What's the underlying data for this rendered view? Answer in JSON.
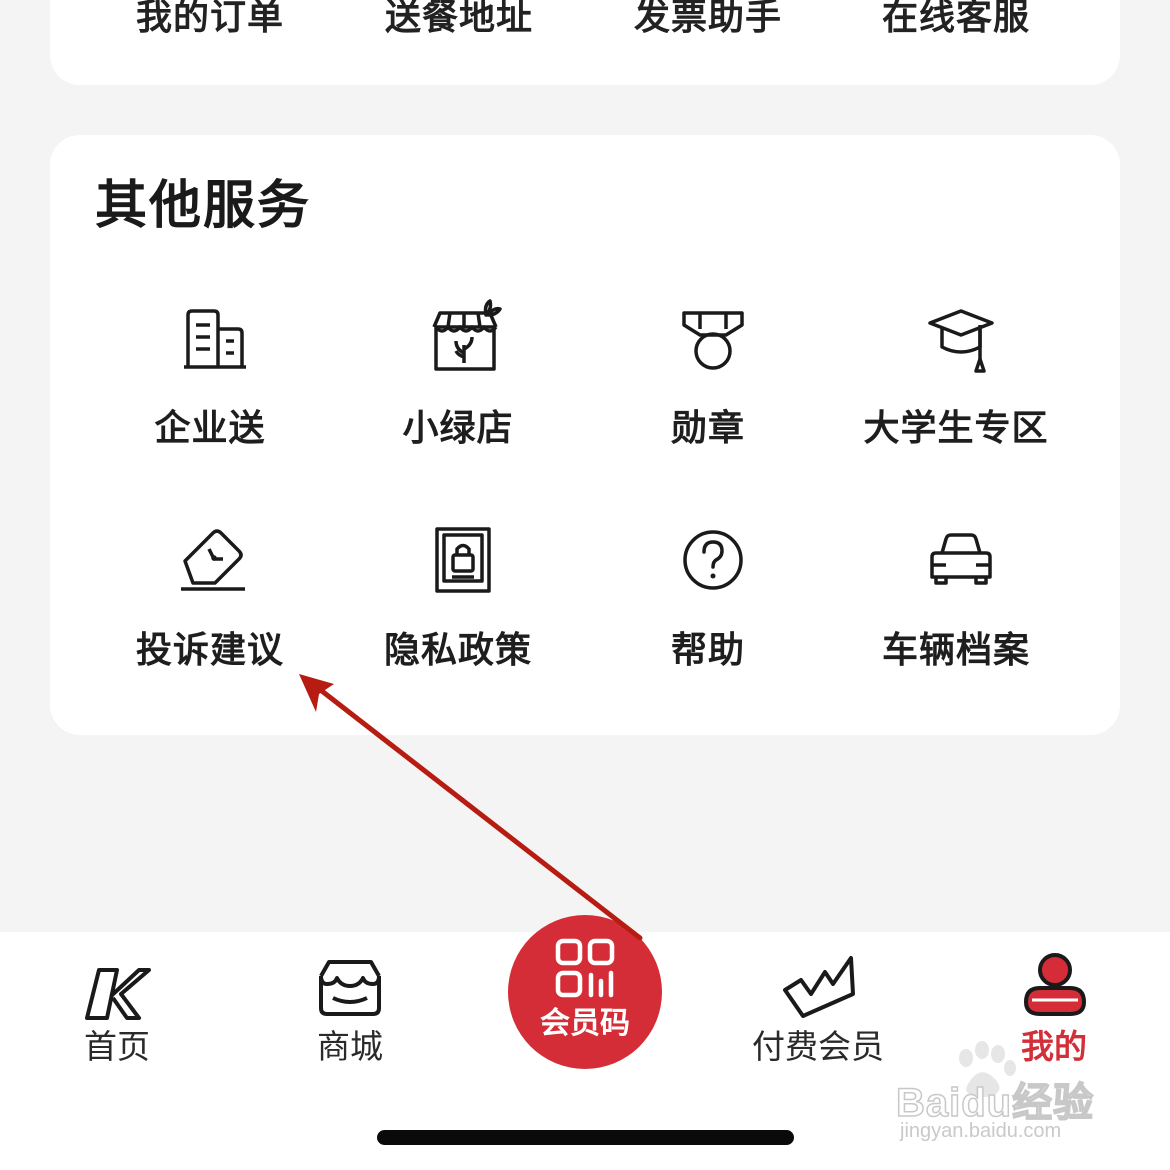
{
  "top_menu": {
    "items": [
      {
        "label": "我的订单"
      },
      {
        "label": "送餐地址"
      },
      {
        "label": "发票助手"
      },
      {
        "label": "在线客服"
      }
    ]
  },
  "other_services": {
    "title": "其他服务",
    "items": [
      {
        "label": "企业送",
        "icon": "building-icon"
      },
      {
        "label": "小绿店",
        "icon": "green-store-icon"
      },
      {
        "label": "勋章",
        "icon": "medal-icon"
      },
      {
        "label": "大学生专区",
        "icon": "graduation-cap-icon"
      },
      {
        "label": "投诉建议",
        "icon": "feedback-card-icon"
      },
      {
        "label": "隐私政策",
        "icon": "privacy-lock-icon"
      },
      {
        "label": "帮助",
        "icon": "help-question-icon"
      },
      {
        "label": "车辆档案",
        "icon": "car-icon"
      }
    ]
  },
  "tabbar": {
    "tabs": [
      {
        "label": "首页",
        "icon": "kfc-k-logo-icon"
      },
      {
        "label": "商城",
        "icon": "store-icon"
      },
      {
        "label": "付费会员",
        "icon": "crown-icon"
      },
      {
        "label": "我的",
        "icon": "user-icon",
        "active": true
      }
    ],
    "center_button": {
      "label": "会员码",
      "icon": "qr-code-icon"
    }
  },
  "colors": {
    "accent_red": "#d42d37",
    "annotation_arrow": "#b71c12",
    "background": "#f4f4f4"
  },
  "watermark": {
    "brand": "Baidu经验",
    "url": "jingyan.baidu.com"
  }
}
